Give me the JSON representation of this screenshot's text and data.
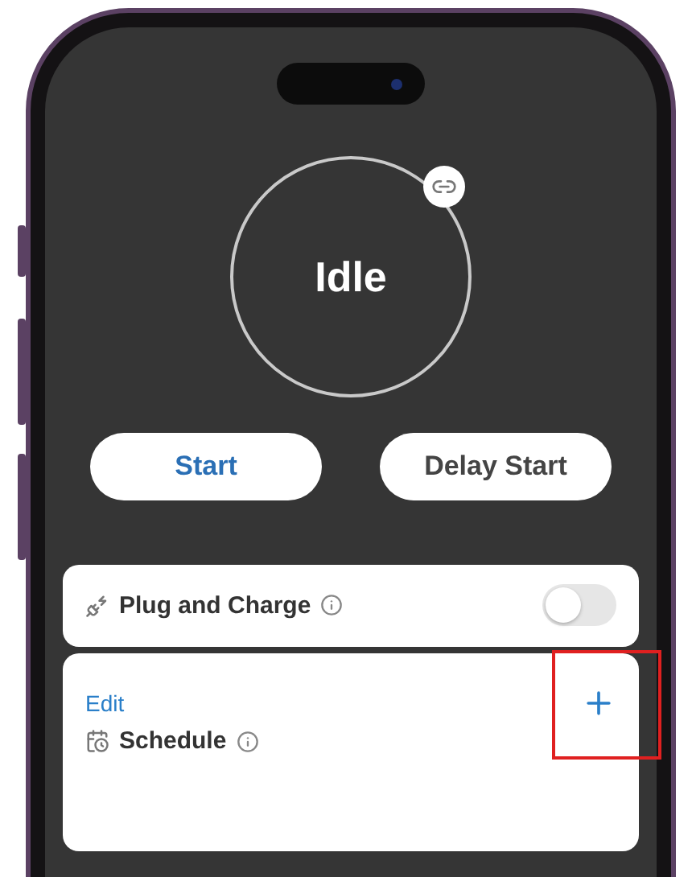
{
  "status": {
    "label": "Idle"
  },
  "actions": [
    {
      "label": "Start",
      "kind": "primary"
    },
    {
      "label": "Delay Start",
      "kind": "secondary"
    }
  ],
  "plug_and_charge": {
    "label": "Plug and Charge",
    "on": false
  },
  "schedule": {
    "edit_label": "Edit",
    "label": "Schedule"
  }
}
